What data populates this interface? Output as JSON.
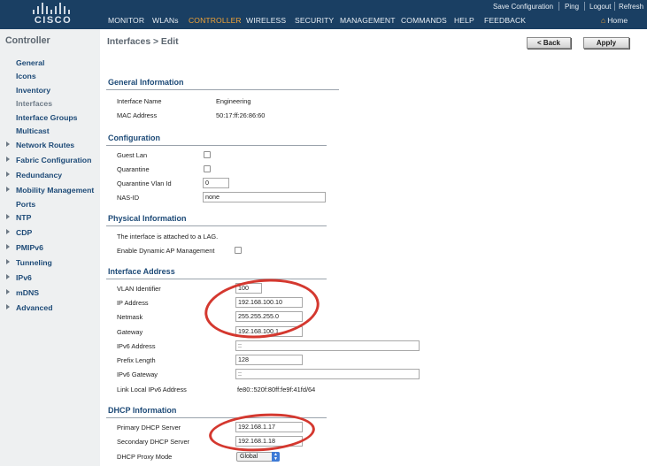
{
  "header": {
    "logo_text": "CISCO",
    "utility_links": [
      "Save Configuration",
      "Ping",
      "Logout",
      "Refresh"
    ],
    "nav": [
      "MONITOR",
      "WLANs",
      "CONTROLLER",
      "WIRELESS",
      "SECURITY",
      "MANAGEMENT",
      "COMMANDS",
      "HELP",
      "FEEDBACK"
    ],
    "active_nav": "CONTROLLER",
    "home_label": "Home",
    "colors": {
      "bar": "#1a3f63",
      "active": "#f0a236"
    }
  },
  "sidebar": {
    "title": "Controller",
    "items": [
      {
        "label": "General",
        "expandable": false
      },
      {
        "label": "Icons",
        "expandable": false
      },
      {
        "label": "Inventory",
        "expandable": false
      },
      {
        "label": "Interfaces",
        "expandable": false,
        "selected": true
      },
      {
        "label": "Interface Groups",
        "expandable": false
      },
      {
        "label": "Multicast",
        "expandable": false
      },
      {
        "label": "Network Routes",
        "expandable": true
      },
      {
        "label": "Fabric Configuration",
        "expandable": true
      },
      {
        "label": "Redundancy",
        "expandable": true
      },
      {
        "label": "Mobility Management",
        "expandable": true
      },
      {
        "label": "Ports",
        "expandable": false
      },
      {
        "label": "NTP",
        "expandable": true
      },
      {
        "label": "CDP",
        "expandable": true
      },
      {
        "label": "PMIPv6",
        "expandable": true
      },
      {
        "label": "Tunneling",
        "expandable": true
      },
      {
        "label": "IPv6",
        "expandable": true
      },
      {
        "label": "mDNS",
        "expandable": true
      },
      {
        "label": "Advanced",
        "expandable": true
      }
    ]
  },
  "page": {
    "title": "Interfaces > Edit",
    "back_label": "< Back",
    "apply_label": "Apply"
  },
  "general": {
    "heading": "General Information",
    "interface_name_label": "Interface Name",
    "interface_name": "Engineering",
    "mac_label": "MAC Address",
    "mac": "50:17:ff:26:86:60"
  },
  "configuration": {
    "heading": "Configuration",
    "guest_lan_label": "Guest Lan",
    "guest_lan": false,
    "quarantine_label": "Quarantine",
    "quarantine": false,
    "quarantine_vlan_label": "Quarantine Vlan Id",
    "quarantine_vlan": "0",
    "nas_id_label": "NAS-ID",
    "nas_id": "none"
  },
  "physical": {
    "heading": "Physical Information",
    "lag_text": "The interface is attached to a LAG.",
    "dynamic_ap_label": "Enable Dynamic AP Management",
    "dynamic_ap": false
  },
  "address": {
    "heading": "Interface Address",
    "vlan_label": "VLAN Identifier",
    "vlan": "100",
    "ip_label": "IP Address",
    "ip": "192.168.100.10",
    "netmask_label": "Netmask",
    "netmask": "255.255.255.0",
    "gateway_label": "Gateway",
    "gateway": "192.168.100.1",
    "ipv6_label": "IPv6 Address",
    "ipv6": "::",
    "prefix_label": "Prefix Length",
    "prefix": "128",
    "ipv6_gateway_label": "IPv6 Gateway",
    "ipv6_gateway": "::",
    "link_local_label": "Link Local IPv6 Address",
    "link_local": "fe80::520f:80ff:fe9f:41fd/64"
  },
  "dhcp": {
    "heading": "DHCP Information",
    "primary_label": "Primary DHCP Server",
    "primary": "192.168.1.17",
    "secondary_label": "Secondary DHCP Server",
    "secondary": "192.168.1.18",
    "proxy_label": "DHCP Proxy Mode",
    "proxy_mode": "Global"
  },
  "annotation_color": "#d4382f"
}
